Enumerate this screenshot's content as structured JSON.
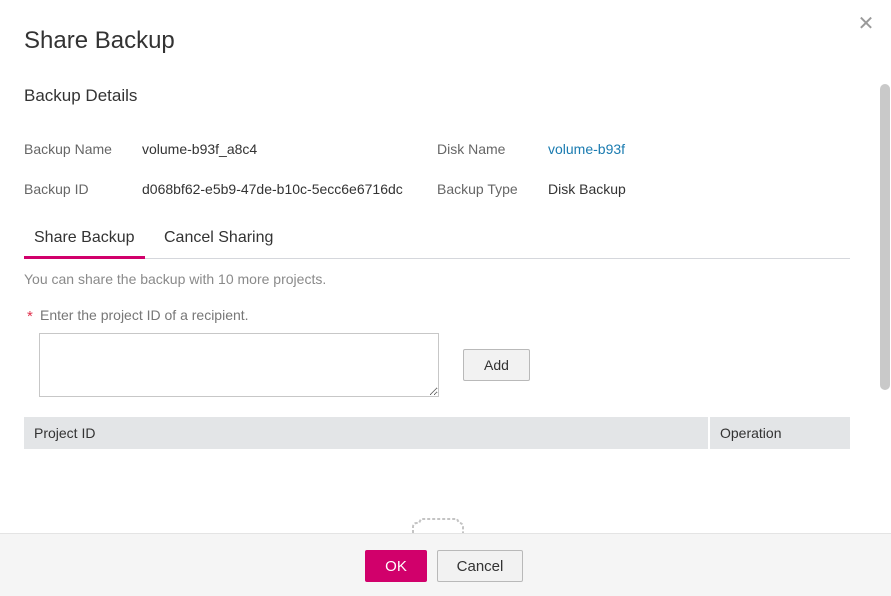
{
  "dialog": {
    "title": "Share Backup",
    "close_icon": "close-icon"
  },
  "details": {
    "section_title": "Backup Details",
    "backup_name_label": "Backup Name",
    "backup_name_value": "volume-b93f_a8c4",
    "disk_name_label": "Disk Name",
    "disk_name_value": "volume-b93f",
    "backup_id_label": "Backup ID",
    "backup_id_value": "d068bf62-e5b9-47de-b10c-5ecc6e6716dc",
    "backup_type_label": "Backup Type",
    "backup_type_value": "Disk Backup"
  },
  "tabs": [
    {
      "label": "Share Backup",
      "active": true
    },
    {
      "label": "Cancel Sharing",
      "active": false
    }
  ],
  "share": {
    "hint": "You can share the backup with 10 more projects.",
    "required_mark": "*",
    "project_label": "Enter the project ID of a recipient.",
    "project_value": "",
    "add_label": "Add"
  },
  "table": {
    "col_project": "Project ID",
    "col_operation": "Operation",
    "empty_icon": "empty-box-icon"
  },
  "footer": {
    "ok_label": "OK",
    "cancel_label": "Cancel"
  },
  "colors": {
    "accent": "#d1006b",
    "link": "#1a7bb0",
    "required": "#e0304c"
  }
}
